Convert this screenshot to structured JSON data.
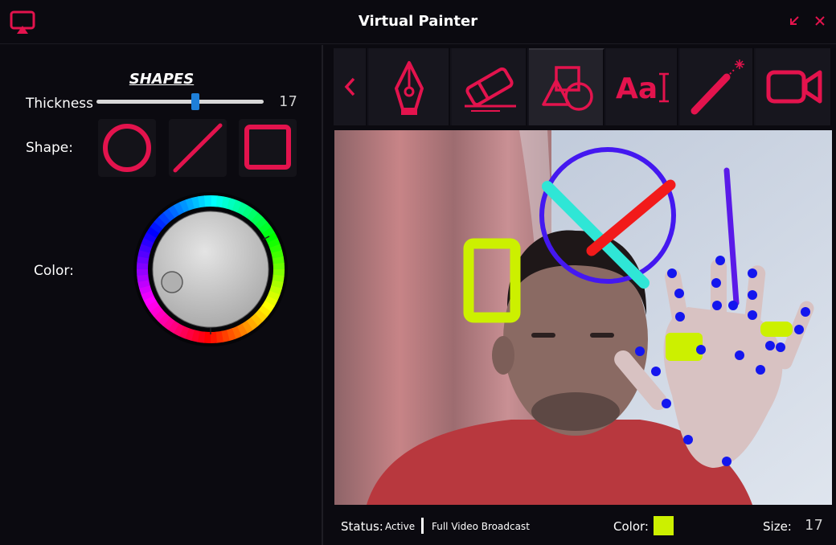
{
  "window": {
    "title": "Virtual Painter"
  },
  "left_panel": {
    "section_title": "SHAPES",
    "thickness_label": "Thickness",
    "thickness_value": "17",
    "thickness_fraction": 0.59,
    "shape_label": "Shape:",
    "shapes": [
      "circle-icon",
      "line-icon",
      "square-icon"
    ],
    "color_label": "Color:"
  },
  "toolbar": {
    "tools": [
      "back",
      "pen",
      "eraser",
      "shapes",
      "text",
      "laser",
      "camera"
    ],
    "active_tool": "shapes",
    "text_tool_glyph": "Aa"
  },
  "status_bar": {
    "status_label": "Status:",
    "status_value": "Active",
    "mode": "Full Video Broadcast",
    "color_label": "Color:",
    "size_label": "Size:",
    "size_value": "17"
  },
  "colors": {
    "accent": "#e3134d",
    "current_color": "#ccf000",
    "background": "#0b0a10",
    "slider_thumb": "#1e7fd8"
  }
}
